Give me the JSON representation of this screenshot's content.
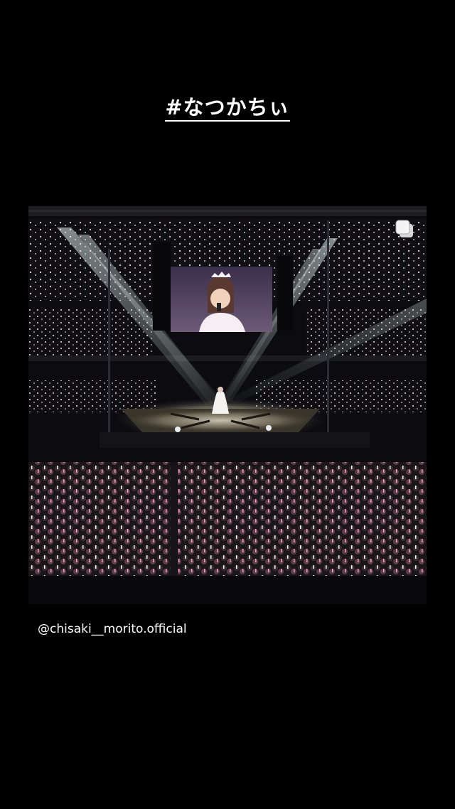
{
  "story": {
    "hashtag": "#なつかちぃ",
    "mention": "@chisaki__morito.official"
  },
  "photo": {
    "subject": "concert arena with performer on stage and large screen"
  },
  "icons": {
    "photo_overlay": "copy-icon"
  },
  "colors": {
    "background": "#000000",
    "text": "#ffffff"
  }
}
